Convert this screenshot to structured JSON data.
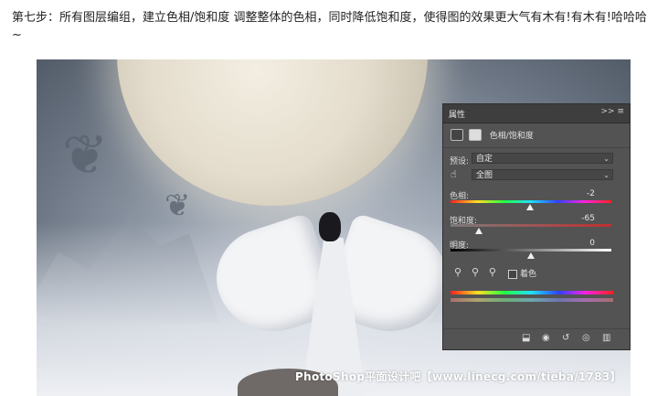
{
  "article": {
    "intro": "第七步：所有图层编组，建立色相/饱和度 调整整体的色相，同时降低饱和度，使得图的效果更大气有木有!有木有!哈哈哈~"
  },
  "watermark": "PhotoShop平面设计吧【www.linecg.com/tieba/1783】",
  "panel": {
    "title": "属性",
    "menu_glyph": ">>",
    "adjustment_type": "色相/饱和度",
    "preset_label": "预设:",
    "preset_value": "自定",
    "channel_value": "全图",
    "hue": {
      "label": "色相:",
      "value": "-2",
      "level": -2,
      "min": -180,
      "max": 180
    },
    "saturation": {
      "label": "饱和度:",
      "value": "-65",
      "level": -65,
      "min": -100,
      "max": 100
    },
    "lightness": {
      "label": "明度:",
      "value": "0",
      "level": 0,
      "min": -100,
      "max": 100
    },
    "colorize_label": "着色",
    "colorize_checked": false,
    "tool_icons": [
      "eyedropper-icon",
      "eyedropper-plus-icon",
      "eyedropper-minus-icon"
    ],
    "bottom_icons": [
      "clip-to-layer-icon",
      "view-previous-icon",
      "reset-icon",
      "visibility-icon",
      "trash-icon"
    ]
  },
  "colors": {
    "panel_bg": "#535353",
    "panel_header": "#3e3e3e"
  }
}
